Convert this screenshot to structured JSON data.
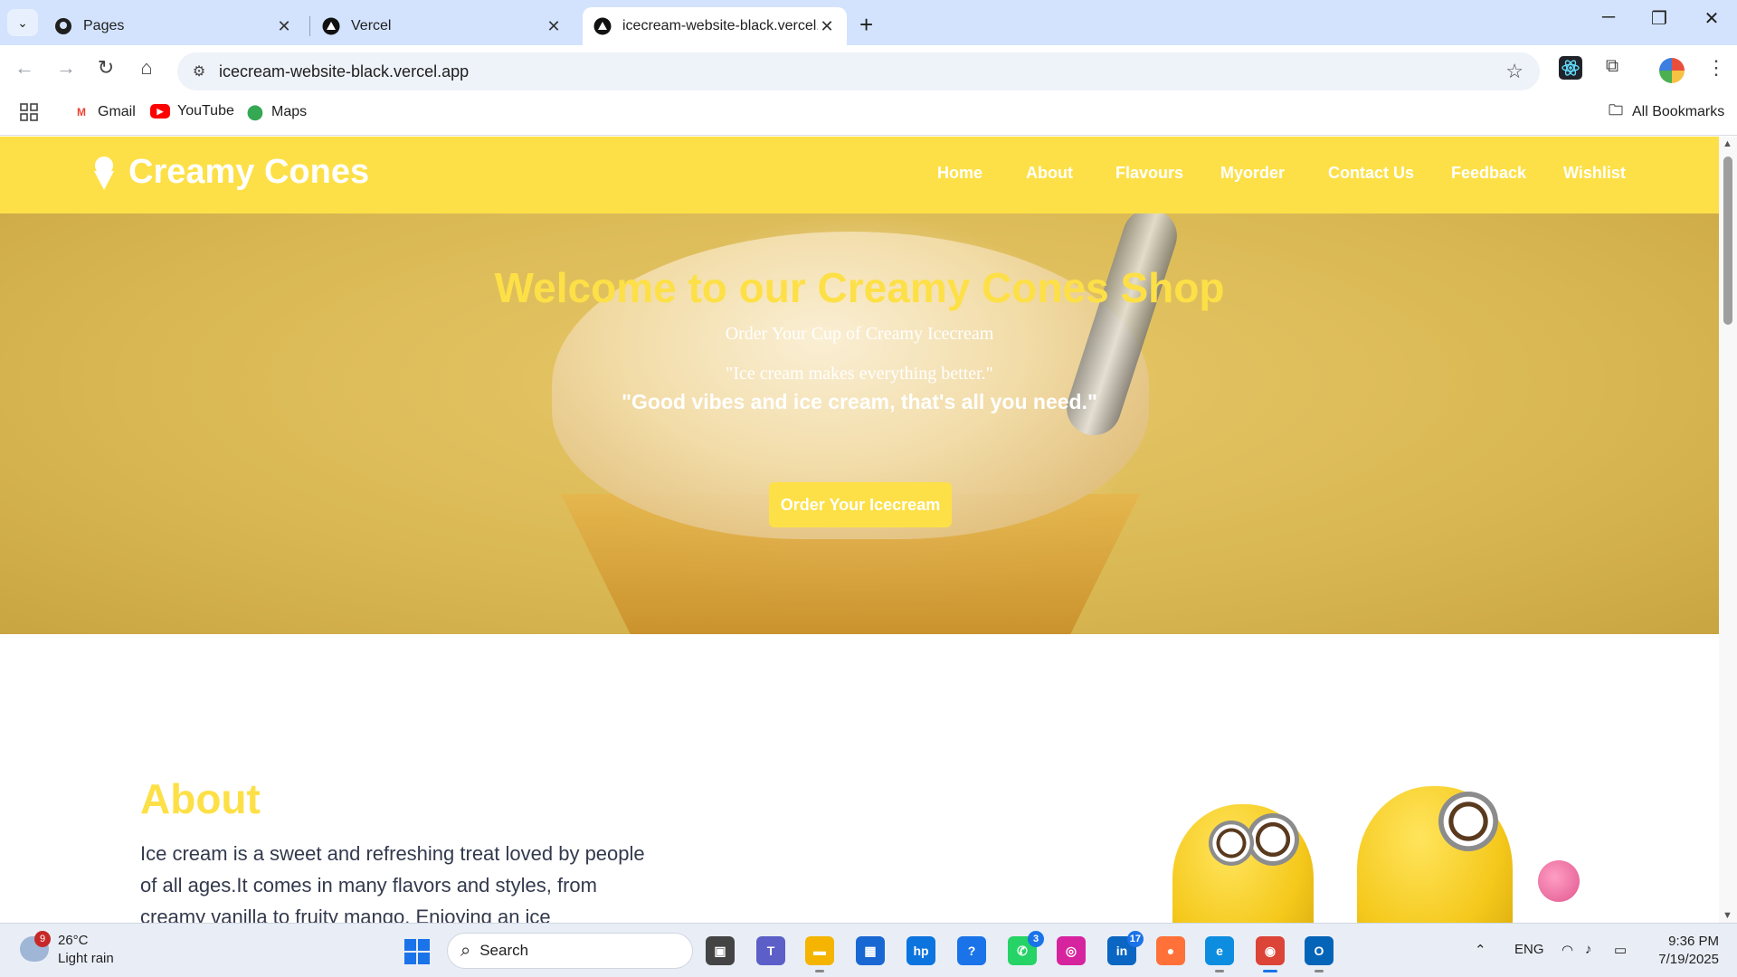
{
  "browser": {
    "tabs": [
      {
        "title": "Pages",
        "favicon": "github-icon",
        "active": false
      },
      {
        "title": "Vercel",
        "favicon": "vercel-icon",
        "active": false
      },
      {
        "title": "icecream-website-black.vercel.a",
        "favicon": "vercel-icon",
        "active": true
      }
    ],
    "address": "icecream-website-black.vercel.app",
    "bookmarks": [
      {
        "label": "Gmail",
        "icon": "gmail-icon"
      },
      {
        "label": "YouTube",
        "icon": "youtube-icon"
      },
      {
        "label": "Maps",
        "icon": "maps-icon"
      }
    ],
    "all_bookmarks": "All Bookmarks"
  },
  "site": {
    "brand": "Creamy Cones",
    "nav": [
      "Home",
      "About",
      "Flavours",
      "Myorder",
      "Contact Us",
      "Feedback",
      "Wishlist"
    ],
    "accent": "#fde047",
    "hero": {
      "title": "Welcome to our Creamy Cones Shop",
      "subtitle": "Order Your Cup of Creamy Icecream",
      "quote1": "\"Ice cream makes everything better.\"",
      "quote2": "\"Good vibes and ice cream, that's all you need.\"",
      "button": "Order Your Icecream"
    },
    "about": {
      "title": "About",
      "text": "Ice cream is a sweet and refreshing treat loved by people of all ages.It comes in many flavors and styles, from creamy vanilla to fruity mango. Enjoying an ice"
    }
  },
  "taskbar": {
    "weather_temp": "26°C",
    "weather_desc": "Light rain",
    "weather_badge": "9",
    "search_placeholder": "Search",
    "teams_badge": "3",
    "linkedin_badge": "17",
    "language": "ENG",
    "time": "9:36 PM",
    "date": "7/19/2025"
  }
}
